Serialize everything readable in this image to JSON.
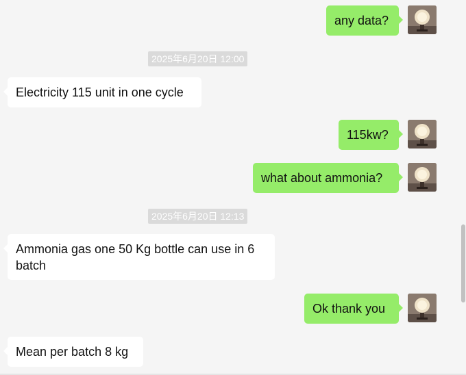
{
  "messages": [
    {
      "id": "m1",
      "direction": "outgoing",
      "text": "any data?"
    },
    {
      "id": "ts1",
      "type": "timestamp",
      "text": "2025年6月20日 12:00"
    },
    {
      "id": "m2",
      "direction": "incoming",
      "text": "Electricity 115 unit in one cycle"
    },
    {
      "id": "m3",
      "direction": "outgoing",
      "text": "115kw?"
    },
    {
      "id": "m4",
      "direction": "outgoing",
      "text": "what about ammonia?"
    },
    {
      "id": "ts2",
      "type": "timestamp",
      "text": "2025年6月20日 12:13"
    },
    {
      "id": "m5",
      "direction": "incoming",
      "text": "Ammonia gas one 50 Kg bottle can use in 6 batch"
    },
    {
      "id": "m6",
      "direction": "outgoing",
      "text": "Ok thank you"
    },
    {
      "id": "m7",
      "direction": "incoming",
      "text": "Mean per batch 8 kg"
    }
  ],
  "colors": {
    "outgoing_bubble": "#95ec69",
    "incoming_bubble": "#ffffff",
    "background": "#f5f5f5",
    "timestamp_bg": "#dadada"
  },
  "avatar_icon": "globe-lamp-photo"
}
